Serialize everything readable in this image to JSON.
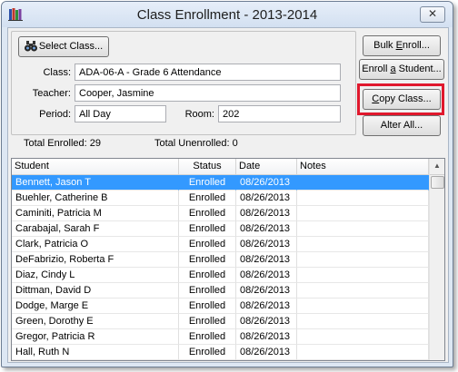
{
  "window": {
    "title": "Class Enrollment - 2013-2014",
    "close_glyph": "✕"
  },
  "form": {
    "select_class_label": "Select Class...",
    "class_label": "Class:",
    "class_value": "ADA-06-A - Grade 6 Attendance",
    "teacher_label": "Teacher:",
    "teacher_value": "Cooper, Jasmine",
    "period_label": "Period:",
    "period_value": "All Day",
    "room_label": "Room:",
    "room_value": "202"
  },
  "buttons": {
    "bulk_enroll_pre": "Bulk ",
    "bulk_enroll_u": "E",
    "bulk_enroll_post": "nroll...",
    "enroll_student_pre": "Enroll ",
    "enroll_student_u": "a",
    "enroll_student_post": " Student...",
    "copy_class_u": "C",
    "copy_class_post": "opy Class...",
    "alter_all_label": "Alter All..."
  },
  "totals": {
    "enrolled": "Total Enrolled: 29",
    "unenrolled": "Total Unenrolled: 0"
  },
  "table": {
    "columns": [
      "Student",
      "Status",
      "Date",
      "Notes"
    ],
    "rows": [
      {
        "student": "Bennett, Jason T",
        "status": "Enrolled",
        "date": "08/26/2013",
        "notes": ""
      },
      {
        "student": "Buehler, Catherine B",
        "status": "Enrolled",
        "date": "08/26/2013",
        "notes": ""
      },
      {
        "student": "Caminiti, Patricia M",
        "status": "Enrolled",
        "date": "08/26/2013",
        "notes": ""
      },
      {
        "student": "Carabajal, Sarah F",
        "status": "Enrolled",
        "date": "08/26/2013",
        "notes": ""
      },
      {
        "student": "Clark, Patricia O",
        "status": "Enrolled",
        "date": "08/26/2013",
        "notes": ""
      },
      {
        "student": "DeFabrizio, Roberta F",
        "status": "Enrolled",
        "date": "08/26/2013",
        "notes": ""
      },
      {
        "student": "Diaz, Cindy L",
        "status": "Enrolled",
        "date": "08/26/2013",
        "notes": ""
      },
      {
        "student": "Dittman, David D",
        "status": "Enrolled",
        "date": "08/26/2013",
        "notes": ""
      },
      {
        "student": "Dodge, Marge E",
        "status": "Enrolled",
        "date": "08/26/2013",
        "notes": ""
      },
      {
        "student": "Green, Dorothy E",
        "status": "Enrolled",
        "date": "08/26/2013",
        "notes": ""
      },
      {
        "student": "Gregor, Patricia R",
        "status": "Enrolled",
        "date": "08/26/2013",
        "notes": ""
      },
      {
        "student": "Hall, Ruth N",
        "status": "Enrolled",
        "date": "08/26/2013",
        "notes": ""
      }
    ]
  },
  "colors": {
    "selection": "#3399ff",
    "highlight_box": "#e0182d",
    "window_bg": "#dde7f3"
  },
  "icons": {
    "app": "books-icon",
    "select_class": "binoculars-icon",
    "close": "close-icon",
    "scroll_up": "scroll-up-arrow-icon"
  }
}
